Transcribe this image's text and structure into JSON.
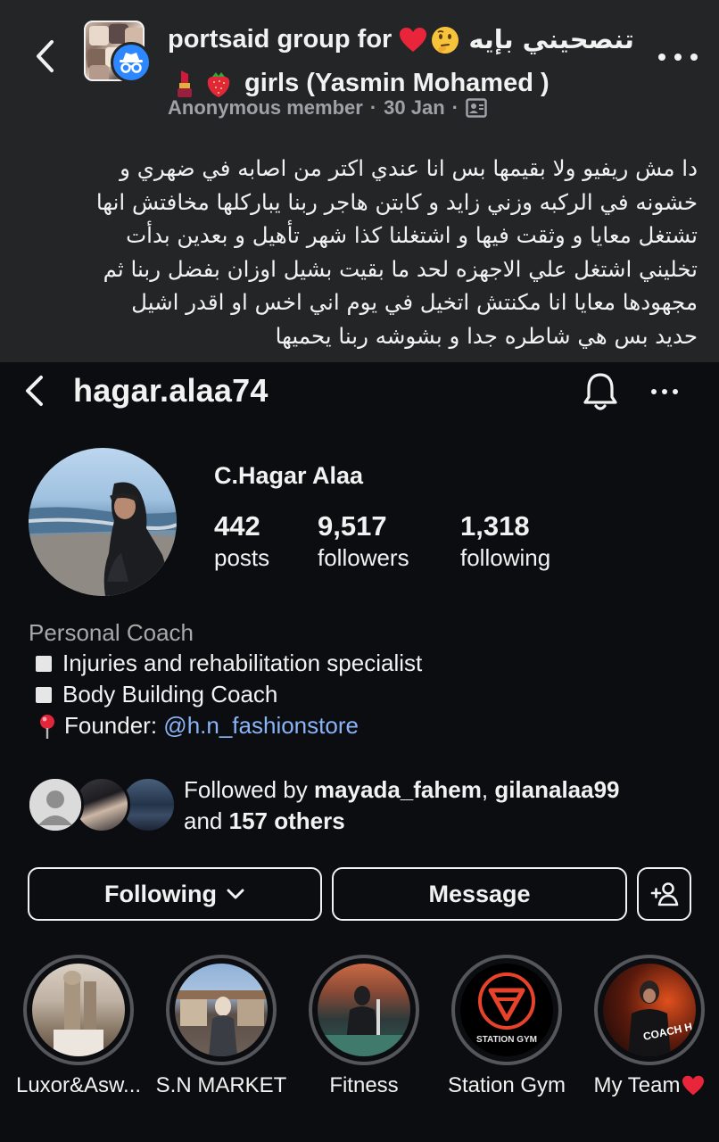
{
  "post": {
    "group_name_line1": "portsaid group for",
    "group_name_arabic": "تنصحيني بإيه",
    "group_name_line2": "girls (Yasmin Mohamed )",
    "author": "Anonymous member",
    "date": "30 Jan",
    "body_lines": [
      "دا مش ريفيو ولا بقيمها بس انا عندي اكتر من اصابه في ضهري و",
      "خشونه في الركبه وزني زايد و كابتن هاجر ربنا يباركلها مخافتش انها",
      "تشتغل معايا و وثقت فيها و اشتغلنا كذا شهر تأهيل و بعدين بدأت",
      "تخليني اشتغل علي الاجهزه لحد ما بقيت بشيل اوزان بفضل ربنا ثم",
      "مجهودها معايا انا مكنتش اتخيل في يوم اني اخس او اقدر اشيل",
      "حديد بس هي شاطره جدا و بشوشه ربنا يحميها"
    ]
  },
  "profile": {
    "username": "hagar.alaa74",
    "display_name": "C.Hagar Alaa",
    "stats": [
      {
        "value": "442",
        "label": "posts"
      },
      {
        "value": "9,517",
        "label": "followers"
      },
      {
        "value": "1,318",
        "label": "following"
      }
    ],
    "category": "Personal Coach",
    "bio": {
      "line1": "Injuries and rehabilitation specialist",
      "line2": "Body Building Coach",
      "founder_prefix": "Founder: ",
      "founder_link": "@h.n_fashionstore"
    },
    "followed_by": {
      "prefix": "Followed by ",
      "user1": "mayada_fahem",
      "separator": ", ",
      "user2": "gilanalaa99",
      "and": "and ",
      "others": "157 others"
    },
    "buttons": {
      "following": "Following",
      "message": "Message"
    },
    "highlights": [
      {
        "label": "Luxor&Asw..."
      },
      {
        "label": "S.N MARKET"
      },
      {
        "label": "Fitness"
      },
      {
        "label": "Station Gym",
        "logo_text": "STATION GYM"
      },
      {
        "label": "My Team",
        "logo_text": "COACH HAGAR"
      }
    ]
  },
  "colors": {
    "fb_background": "#242526",
    "ig_background": "#0c0d10",
    "link": "#8ab4f8",
    "badge_blue": "#2d88ff",
    "muted": "#a8a8a8"
  },
  "icons": [
    "back-chevron-icon",
    "anonymous-incognito-icon",
    "red-heart-emoji",
    "thinking-face-emoji",
    "lipstick-emoji",
    "strawberry-emoji",
    "contact-card-icon",
    "more-dots-icon",
    "notification-bell-icon",
    "round-pushpin-emoji",
    "chevron-down-icon",
    "add-person-icon",
    "default-avatar-icon"
  ]
}
